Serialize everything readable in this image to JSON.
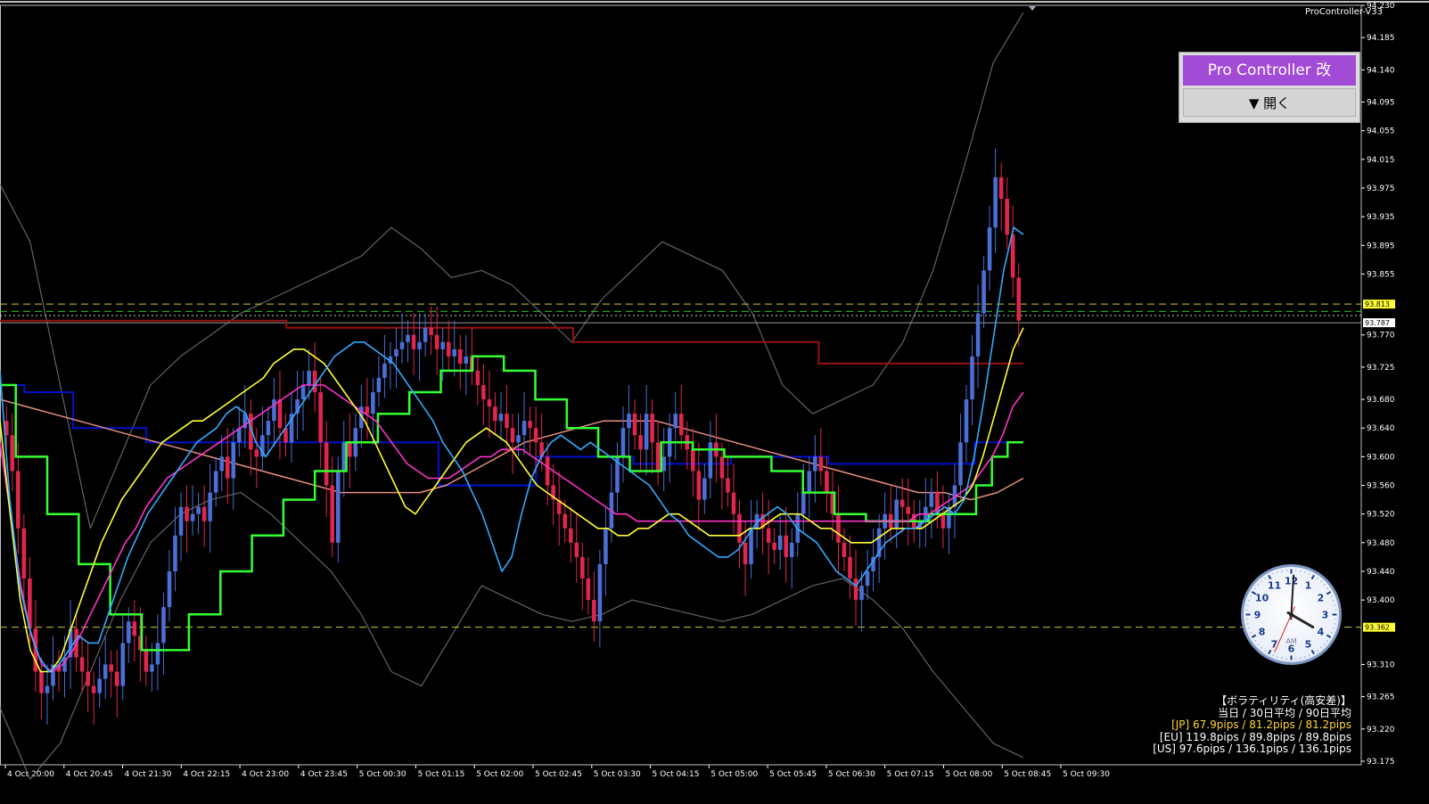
{
  "ea_title": "ProController-V33",
  "panel": {
    "header": "Pro Controller 改",
    "open_button": "▼ 開く"
  },
  "volatility": {
    "title": "【ボラティリティ(高安差)】",
    "subtitle": "当日 / 30日平均 / 90日平均",
    "jp": "[JP] 67.9pips / 81.2pips / 81.2pips",
    "eu": "[EU] 119.8pips / 89.8pips / 89.8pips",
    "us": "[US] 97.6pips / 136.1pips / 136.1pips"
  },
  "clock": {
    "label": "AM",
    "hour": 4,
    "minute": 0,
    "second": 34
  },
  "colors": {
    "bull": "#4a6fd6",
    "bear": "#e0264d",
    "ema_fast": "#33aaff",
    "ema_mid": "#ffff33",
    "ema_slow": "#ff33cc",
    "step_green": "#33ff33",
    "step_blue": "#0011cc",
    "step_red": "#991111",
    "ma_salmon": "#e88f7f",
    "bands": "#6e6e6e"
  },
  "chart_data": {
    "type": "candlestick",
    "symbol_hint": "price chart",
    "ylim": [
      93.17,
      94.23
    ],
    "y_ticks": [
      94.23,
      94.185,
      94.14,
      94.095,
      94.055,
      94.015,
      93.975,
      93.935,
      93.895,
      93.855,
      93.77,
      93.725,
      93.68,
      93.64,
      93.6,
      93.56,
      93.52,
      93.48,
      93.44,
      93.4,
      93.31,
      93.265,
      93.22,
      93.175
    ],
    "x_ticks": [
      "4 Oct 20:00",
      "4 Oct 20:45",
      "4 Oct 21:30",
      "4 Oct 22:15",
      "4 Oct 23:00",
      "4 Oct 23:45",
      "5 Oct 00:30",
      "5 Oct 01:15",
      "5 Oct 02:00",
      "5 Oct 02:45",
      "5 Oct 03:30",
      "5 Oct 04:15",
      "5 Oct 05:00",
      "5 Oct 05:45",
      "5 Oct 06:30",
      "5 Oct 07:15",
      "5 Oct 08:00",
      "5 Oct 08:45",
      "5 Oct 09:30"
    ],
    "price_labels": [
      {
        "text": "93.813",
        "value": 93.813,
        "bg": "#ffff33",
        "color": "#000000"
      },
      {
        "text": "93.787",
        "value": 93.787,
        "bg": "#ffffff",
        "color": "#000000"
      },
      {
        "text": "93.362",
        "value": 93.362,
        "bg": "#ffff33",
        "color": "#000000"
      }
    ],
    "hlines": [
      {
        "value": 93.813,
        "color": "#cccc33",
        "style": "dash"
      },
      {
        "value": 93.803,
        "color": "#33cc33",
        "style": "dash"
      },
      {
        "value": 93.797,
        "color": "#cccccc",
        "style": "dot"
      },
      {
        "value": 93.787,
        "color": "#999999",
        "style": "solid"
      },
      {
        "value": 93.362,
        "color": "#cccc33",
        "style": "dash"
      }
    ],
    "closes": [
      93.63,
      93.58,
      93.5,
      93.43,
      93.36,
      93.3,
      93.27,
      93.28,
      93.31,
      93.3,
      93.32,
      93.36,
      93.32,
      93.3,
      93.28,
      93.27,
      93.29,
      93.31,
      93.3,
      93.28,
      93.34,
      93.37,
      93.35,
      93.33,
      93.3,
      93.31,
      93.34,
      93.39,
      93.44,
      93.49,
      93.53,
      93.51,
      93.52,
      93.53,
      93.51,
      93.55,
      93.58,
      93.6,
      93.57,
      93.62,
      93.64,
      93.66,
      93.61,
      93.6,
      93.63,
      93.65,
      93.68,
      93.64,
      93.62,
      93.66,
      93.68,
      93.7,
      93.72,
      93.69,
      93.62,
      93.56,
      93.48,
      93.58,
      93.62,
      93.6,
      93.64,
      93.67,
      93.66,
      93.69,
      93.71,
      93.73,
      93.74,
      93.75,
      93.76,
      93.77,
      93.75,
      93.76,
      93.78,
      93.77,
      93.75,
      93.76,
      93.74,
      93.75,
      93.73,
      93.74,
      93.72,
      93.7,
      93.68,
      93.67,
      93.65,
      93.66,
      93.64,
      93.62,
      93.63,
      93.65,
      93.64,
      93.62,
      93.6,
      93.56,
      93.54,
      93.52,
      93.5,
      93.48,
      93.46,
      93.43,
      93.4,
      93.37,
      93.45,
      93.5,
      93.55,
      93.6,
      93.64,
      93.66,
      93.63,
      93.61,
      93.66,
      93.62,
      93.58,
      93.6,
      93.64,
      93.66,
      93.63,
      93.61,
      93.58,
      93.54,
      93.57,
      93.62,
      93.6,
      93.57,
      93.55,
      93.52,
      93.48,
      93.45,
      93.5,
      93.52,
      93.5,
      93.48,
      93.47,
      93.49,
      93.46,
      93.48,
      93.52,
      93.55,
      93.58,
      93.6,
      93.58,
      93.55,
      93.52,
      93.48,
      93.46,
      93.43,
      93.4,
      93.42,
      93.44,
      93.46,
      93.5,
      93.52,
      93.5,
      93.54,
      93.53,
      93.52,
      93.5,
      93.51,
      93.53,
      93.55,
      93.52,
      93.5,
      93.53,
      93.56,
      93.62,
      93.68,
      93.74,
      93.8,
      93.86,
      93.92,
      93.99,
      93.96,
      93.91,
      93.85,
      93.79
    ],
    "ema_fast": [
      93.72,
      93.54,
      93.42,
      93.36,
      93.32,
      93.3,
      93.31,
      93.33,
      93.35,
      93.34,
      93.34,
      93.38,
      93.42,
      93.46,
      93.49,
      93.52,
      93.54,
      93.56,
      93.58,
      93.6,
      93.62,
      93.63,
      93.64,
      93.66,
      93.67,
      93.66,
      93.62,
      93.6,
      93.62,
      93.64,
      93.66,
      93.68,
      93.7,
      93.72,
      93.74,
      93.75,
      93.76,
      93.76,
      93.75,
      93.74,
      93.73,
      93.71,
      93.69,
      93.67,
      93.65,
      93.62,
      93.6,
      93.58,
      93.55,
      93.52,
      93.48,
      93.44,
      93.46,
      93.52,
      93.57,
      93.6,
      93.62,
      93.63,
      93.62,
      93.61,
      93.62,
      93.61,
      93.6,
      93.59,
      93.58,
      93.57,
      93.56,
      93.54,
      93.52,
      93.51,
      93.49,
      93.48,
      93.47,
      93.46,
      93.46,
      93.47,
      93.49,
      93.51,
      93.52,
      93.53,
      93.52,
      93.5,
      93.49,
      93.48,
      93.46,
      93.44,
      93.43,
      93.42,
      93.44,
      93.46,
      93.48,
      93.49,
      93.5,
      93.5,
      93.51,
      93.52,
      93.53,
      93.52,
      93.54,
      93.6,
      93.68,
      93.77,
      93.86,
      93.92,
      93.91
    ],
    "ema_mid": [
      93.65,
      93.52,
      93.4,
      93.33,
      93.3,
      93.3,
      93.32,
      93.36,
      93.4,
      93.44,
      93.48,
      93.51,
      93.54,
      93.56,
      93.58,
      93.6,
      93.62,
      93.63,
      93.64,
      93.65,
      93.65,
      93.66,
      93.67,
      93.68,
      93.69,
      93.7,
      93.71,
      93.73,
      93.74,
      93.75,
      93.75,
      93.74,
      93.73,
      93.71,
      93.69,
      93.67,
      93.65,
      93.62,
      93.59,
      93.56,
      93.53,
      93.52,
      93.54,
      93.56,
      93.58,
      93.6,
      93.62,
      93.63,
      93.64,
      93.63,
      93.62,
      93.6,
      93.58,
      93.56,
      93.55,
      93.54,
      93.53,
      93.52,
      93.51,
      93.5,
      93.5,
      93.49,
      93.49,
      93.5,
      93.5,
      93.51,
      93.52,
      93.52,
      93.51,
      93.5,
      93.49,
      93.49,
      93.49,
      93.49,
      93.5,
      93.5,
      93.51,
      93.52,
      93.52,
      93.52,
      93.51,
      93.5,
      93.5,
      93.49,
      93.48,
      93.48,
      93.48,
      93.49,
      93.5,
      93.5,
      93.5,
      93.5,
      93.51,
      93.52,
      93.53,
      93.54,
      93.56,
      93.6,
      93.65,
      93.7,
      93.75,
      93.78
    ],
    "ema_slow": [
      93.62,
      93.52,
      93.42,
      93.35,
      93.31,
      93.3,
      93.31,
      93.33,
      93.36,
      93.39,
      93.42,
      93.45,
      93.48,
      93.5,
      93.53,
      93.55,
      93.57,
      93.58,
      93.59,
      93.6,
      93.61,
      93.62,
      93.63,
      93.64,
      93.65,
      93.66,
      93.67,
      93.68,
      93.69,
      93.7,
      93.7,
      93.7,
      93.69,
      93.68,
      93.67,
      93.66,
      93.65,
      93.63,
      93.61,
      93.59,
      93.58,
      93.57,
      93.57,
      93.57,
      93.58,
      93.59,
      93.6,
      93.6,
      93.61,
      93.61,
      93.61,
      93.6,
      93.59,
      93.58,
      93.57,
      93.56,
      93.55,
      93.54,
      93.53,
      93.52,
      93.52,
      93.51,
      93.51,
      93.51,
      93.51,
      93.51,
      93.51,
      93.51,
      93.51,
      93.51,
      93.51,
      93.51,
      93.51,
      93.51,
      93.51,
      93.51,
      93.51,
      93.51,
      93.51,
      93.51,
      93.51,
      93.51,
      93.51,
      93.51,
      93.51,
      93.51,
      93.51,
      93.51,
      93.52,
      93.52,
      93.53,
      93.54,
      93.55,
      93.56,
      93.58,
      93.6,
      93.63,
      93.67,
      93.69
    ],
    "step_green": [
      93.7,
      93.6,
      93.6,
      93.52,
      93.52,
      93.45,
      93.45,
      93.38,
      93.38,
      93.33,
      93.33,
      93.33,
      93.38,
      93.38,
      93.44,
      93.44,
      93.49,
      93.49,
      93.54,
      93.54,
      93.58,
      93.58,
      93.62,
      93.62,
      93.66,
      93.66,
      93.69,
      93.69,
      93.72,
      93.72,
      93.74,
      93.74,
      93.72,
      93.72,
      93.68,
      93.68,
      93.64,
      93.64,
      93.6,
      93.6,
      93.58,
      93.58,
      93.62,
      93.62,
      93.61,
      93.61,
      93.6,
      93.6,
      93.6,
      93.58,
      93.58,
      93.55,
      93.55,
      93.52,
      93.52,
      93.51,
      93.51,
      93.51,
      93.51,
      93.52,
      93.52,
      93.52,
      93.56,
      93.6,
      93.62
    ],
    "step_blue": [
      93.7,
      93.69,
      93.69,
      93.64,
      93.64,
      93.64,
      93.62,
      93.62,
      93.62,
      93.62,
      93.62,
      93.62,
      93.62,
      93.62,
      93.62,
      93.62,
      93.62,
      93.62,
      93.56,
      93.56,
      93.56,
      93.56,
      93.6,
      93.6,
      93.6,
      93.6,
      93.59,
      93.59,
      93.59,
      93.59,
      93.6,
      93.6,
      93.6,
      93.6,
      93.59,
      93.59,
      93.59,
      93.59,
      93.59,
      93.59,
      93.62,
      93.62
    ],
    "step_red": [
      93.79,
      93.79,
      93.79,
      93.79,
      93.79,
      93.79,
      93.79,
      93.78,
      93.78,
      93.78,
      93.78,
      93.78,
      93.78,
      93.78,
      93.76,
      93.76,
      93.76,
      93.76,
      93.76,
      93.76,
      93.73,
      93.73,
      93.73,
      93.73,
      93.73
    ],
    "ma_salmon": [
      93.68,
      93.67,
      93.66,
      93.65,
      93.64,
      93.63,
      93.62,
      93.61,
      93.6,
      93.59,
      93.58,
      93.57,
      93.56,
      93.55,
      93.55,
      93.55,
      93.55,
      93.56,
      93.58,
      93.6,
      93.62,
      93.63,
      93.64,
      93.65,
      93.65,
      93.65,
      93.64,
      93.63,
      93.62,
      93.61,
      93.6,
      93.59,
      93.58,
      93.57,
      93.56,
      93.55,
      93.55,
      93.54,
      93.55,
      93.57
    ],
    "bands_upper": [
      93.98,
      93.9,
      93.7,
      93.5,
      93.6,
      93.7,
      93.74,
      93.77,
      93.8,
      93.82,
      93.84,
      93.86,
      93.88,
      93.92,
      93.89,
      93.85,
      93.86,
      93.84,
      93.8,
      93.76,
      93.82,
      93.86,
      93.9,
      93.88,
      93.86,
      93.8,
      93.7,
      93.66,
      93.68,
      93.7,
      93.76,
      93.86,
      94.0,
      94.15,
      94.22
    ],
    "bands_lower": [
      93.25,
      93.15,
      93.2,
      93.3,
      93.4,
      93.48,
      93.52,
      93.54,
      93.55,
      93.52,
      93.48,
      93.44,
      93.38,
      93.3,
      93.28,
      93.35,
      93.42,
      93.4,
      93.38,
      93.37,
      93.38,
      93.4,
      93.39,
      93.38,
      93.37,
      93.38,
      93.4,
      93.42,
      93.43,
      93.4,
      93.36,
      93.3,
      93.25,
      93.2,
      93.18
    ]
  }
}
